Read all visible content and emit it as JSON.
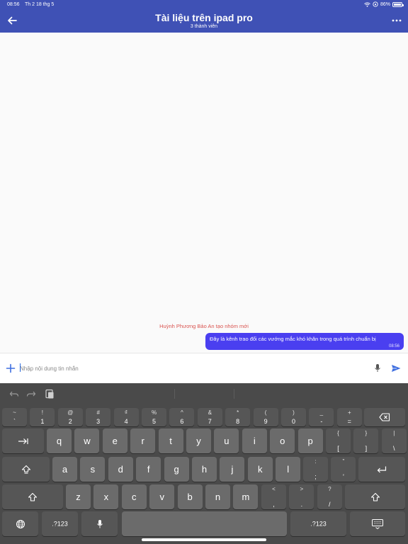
{
  "status": {
    "time": "08:56",
    "date": "Th 2 18 thg 5",
    "battery": "86%",
    "battery_level": 0.86
  },
  "header": {
    "title": "Tài liệu trên ipad pro",
    "subtitle": "3 thành viên",
    "back_icon": "arrow-back-icon",
    "more_icon": "more-icon"
  },
  "chat": {
    "system_message": "Huỳnh Phương Bảo An tạo nhóm mới",
    "messages": [
      {
        "text": "Đây là kênh trao đổi các vướng mắc khó khăn trong quá trình chuẩn bị",
        "time": "08:56"
      }
    ]
  },
  "composer": {
    "placeholder": "Nhập nội dung tin nhắn",
    "value": ""
  },
  "keyboard": {
    "row1": [
      {
        "top": "~",
        "bot": "`"
      },
      {
        "top": "!",
        "bot": "1"
      },
      {
        "top": "@",
        "bot": "2"
      },
      {
        "top": "#",
        "bot": "3"
      },
      {
        "top": "₫",
        "bot": "4"
      },
      {
        "top": "%",
        "bot": "5"
      },
      {
        "top": "^",
        "bot": "6"
      },
      {
        "top": "&",
        "bot": "7"
      },
      {
        "top": "*",
        "bot": "8"
      },
      {
        "top": "(",
        "bot": "9"
      },
      {
        "top": ")",
        "bot": "0"
      },
      {
        "top": "_",
        "bot": "-"
      },
      {
        "top": "+",
        "bot": "="
      }
    ],
    "row2": [
      "q",
      "w",
      "e",
      "r",
      "t",
      "y",
      "u",
      "i",
      "o",
      "p"
    ],
    "row2_brackets": [
      {
        "top": "{",
        "bot": "["
      },
      {
        "top": "}",
        "bot": "]"
      },
      {
        "top": "|",
        "bot": "\\"
      }
    ],
    "row3": [
      "a",
      "s",
      "d",
      "f",
      "g",
      "h",
      "j",
      "k",
      "l"
    ],
    "row3_punct": [
      {
        "top": ":",
        "bot": ";"
      },
      {
        "top": "”",
        "bot": "’"
      }
    ],
    "row4": [
      "z",
      "x",
      "c",
      "v",
      "b",
      "n",
      "m"
    ],
    "row4_punct": [
      {
        "top": "<",
        "bot": ","
      },
      {
        "top": ">",
        "bot": "."
      },
      {
        "top": "?",
        "bot": "/"
      }
    ],
    "num_label_left": ".?123",
    "num_label_right": ".?123"
  },
  "colors": {
    "header": "#3f51b5",
    "bubble": "#4a3ff0",
    "system_text": "#d9534f",
    "keyboard_bg": "#4a4a4a"
  }
}
